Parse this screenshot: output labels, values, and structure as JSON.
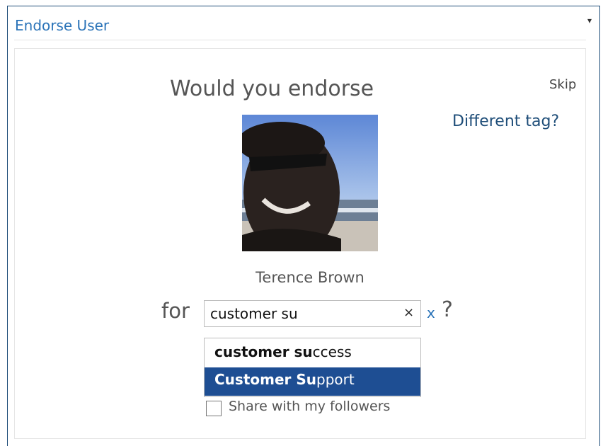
{
  "header": {
    "title": "Endorse User",
    "menu_icon": "chevron-down-icon"
  },
  "card": {
    "question": "Would you endorse",
    "skip_label": "Skip",
    "different_tag_label": "Different tag?",
    "person_name": "Terence Brown",
    "for_label": "for",
    "tag_input_value": "customer su",
    "clear_label": "×",
    "cancel_label": "x",
    "question_mark": "?",
    "suggestions": [
      {
        "match": "customer su",
        "rest": "ccess"
      },
      {
        "match": "Customer Su",
        "rest": "pport"
      }
    ],
    "share_label": "Share with my followers"
  },
  "colors": {
    "accent": "#2a73b8",
    "link": "#1f4e79",
    "highlight": "#1e4e93"
  }
}
